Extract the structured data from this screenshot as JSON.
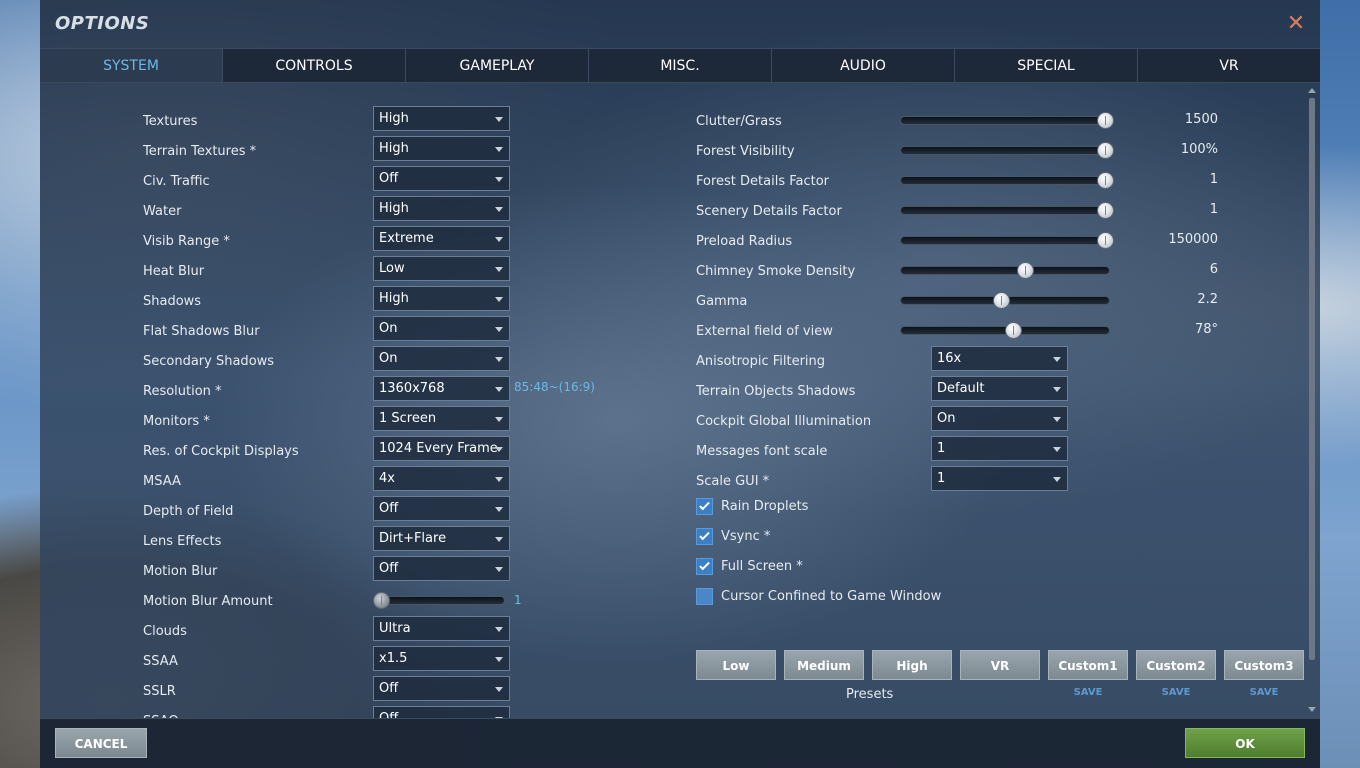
{
  "window": {
    "title": "OPTIONS",
    "close_glyph": "✕"
  },
  "tabs": [
    "SYSTEM",
    "CONTROLS",
    "GAMEPLAY",
    "MISC.",
    "AUDIO",
    "SPECIAL",
    "VR"
  ],
  "active_tab": "SYSTEM",
  "left_settings": [
    {
      "label": "Textures",
      "value": "High"
    },
    {
      "label": "Terrain Textures *",
      "value": "High"
    },
    {
      "label": "Civ. Traffic",
      "value": "Off"
    },
    {
      "label": "Water",
      "value": "High"
    },
    {
      "label": "Visib Range *",
      "value": "Extreme"
    },
    {
      "label": "Heat Blur",
      "value": "Low"
    },
    {
      "label": "Shadows",
      "value": "High"
    },
    {
      "label": "Flat Shadows Blur",
      "value": "On"
    },
    {
      "label": "Secondary Shadows",
      "value": "On"
    },
    {
      "label": "Resolution *",
      "value": "1360x768",
      "extra": "85:48~(16:9)"
    },
    {
      "label": "Monitors *",
      "value": "1 Screen"
    },
    {
      "label": "Res. of Cockpit Displays",
      "value": "1024 Every Frame"
    },
    {
      "label": "MSAA",
      "value": "4x"
    },
    {
      "label": "Depth of Field",
      "value": "Off"
    },
    {
      "label": "Lens Effects",
      "value": "Dirt+Flare"
    },
    {
      "label": "Motion Blur",
      "value": "Off"
    },
    {
      "label": "Motion Blur Amount",
      "slider_value": "1",
      "slider_fraction": 0.0
    },
    {
      "label": "Clouds",
      "value": "Ultra"
    },
    {
      "label": "SSAA",
      "value": "x1.5"
    },
    {
      "label": "SSLR",
      "value": "Off"
    },
    {
      "label": "SSAO",
      "value": "Off"
    }
  ],
  "right_sliders": [
    {
      "label": "Clutter/Grass",
      "value": "1500",
      "fraction": 1.0
    },
    {
      "label": "Forest Visibility",
      "value": "100%",
      "fraction": 1.0
    },
    {
      "label": "Forest Details Factor",
      "value": "1",
      "fraction": 1.0
    },
    {
      "label": "Scenery Details Factor",
      "value": "1",
      "fraction": 1.0
    },
    {
      "label": "Preload Radius",
      "value": "150000",
      "fraction": 1.0
    },
    {
      "label": "Chimney Smoke Density",
      "value": "6",
      "fraction": 0.6
    },
    {
      "label": "Gamma",
      "value": "2.2",
      "fraction": 0.48
    },
    {
      "label": "External field of view",
      "value": "78°",
      "fraction": 0.54
    }
  ],
  "right_dropdowns": [
    {
      "label": "Anisotropic Filtering",
      "value": "16x"
    },
    {
      "label": "Terrain Objects Shadows",
      "value": "Default"
    },
    {
      "label": "Cockpit Global Illumination",
      "value": "On"
    },
    {
      "label": "Messages font scale",
      "value": "1"
    },
    {
      "label": "Scale GUI *",
      "value": "1"
    }
  ],
  "checkboxes": [
    {
      "label": "Rain Droplets",
      "checked": true
    },
    {
      "label": "Vsync *",
      "checked": true
    },
    {
      "label": "Full Screen *",
      "checked": true
    },
    {
      "label": "Cursor Confined to Game Window",
      "checked": false
    }
  ],
  "presets": {
    "label": "Presets",
    "buttons": [
      "Low",
      "Medium",
      "High",
      "VR",
      "Custom1",
      "Custom2",
      "Custom3"
    ],
    "save_label": "SAVE"
  },
  "footer": {
    "cancel_label": "CANCEL",
    "ok_label": "OK"
  },
  "colors": {
    "accent": "#6ab9e6",
    "ok_green": "#5e8f3c",
    "checkbox_blue": "#3b80c6"
  }
}
